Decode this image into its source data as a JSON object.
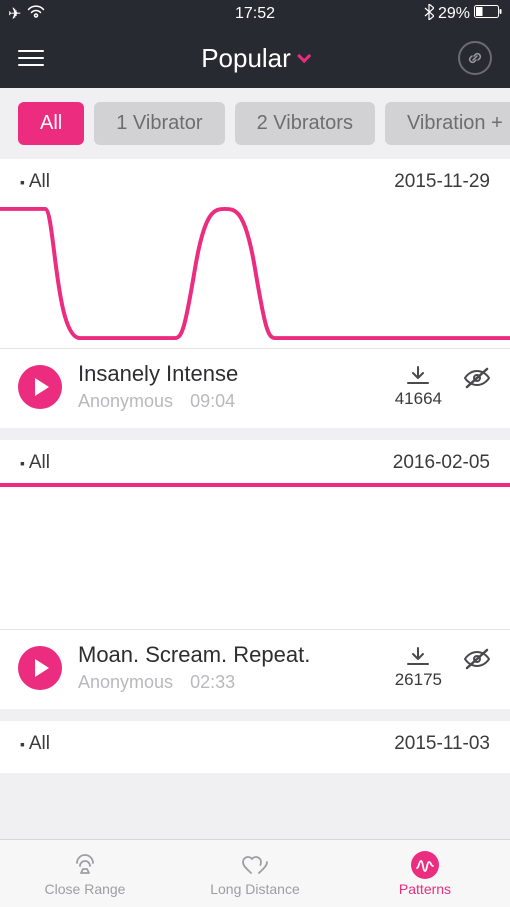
{
  "statusbar": {
    "time": "17:52",
    "battery": "29%"
  },
  "header": {
    "title": "Popular"
  },
  "filters": [
    "All",
    "1 Vibrator",
    "2 Vibrators",
    "Vibration +"
  ],
  "active_filter_index": 0,
  "patterns": [
    {
      "tag": "All",
      "date": "2015-11-29",
      "title": "Insanely Intense",
      "author": "Anonymous",
      "duration": "09:04",
      "downloads": "41664"
    },
    {
      "tag": "All",
      "date": "2016-02-05",
      "title": "Moan. Scream. Repeat.",
      "author": "Anonymous",
      "duration": "02:33",
      "downloads": "26175"
    },
    {
      "tag": "All",
      "date": "2015-11-03",
      "title": "",
      "author": "",
      "duration": "",
      "downloads": ""
    }
  ],
  "tabs": {
    "close_range": "Close Range",
    "long_distance": "Long Distance",
    "patterns": "Patterns"
  },
  "colors": {
    "accent": "#eb2c7f"
  }
}
